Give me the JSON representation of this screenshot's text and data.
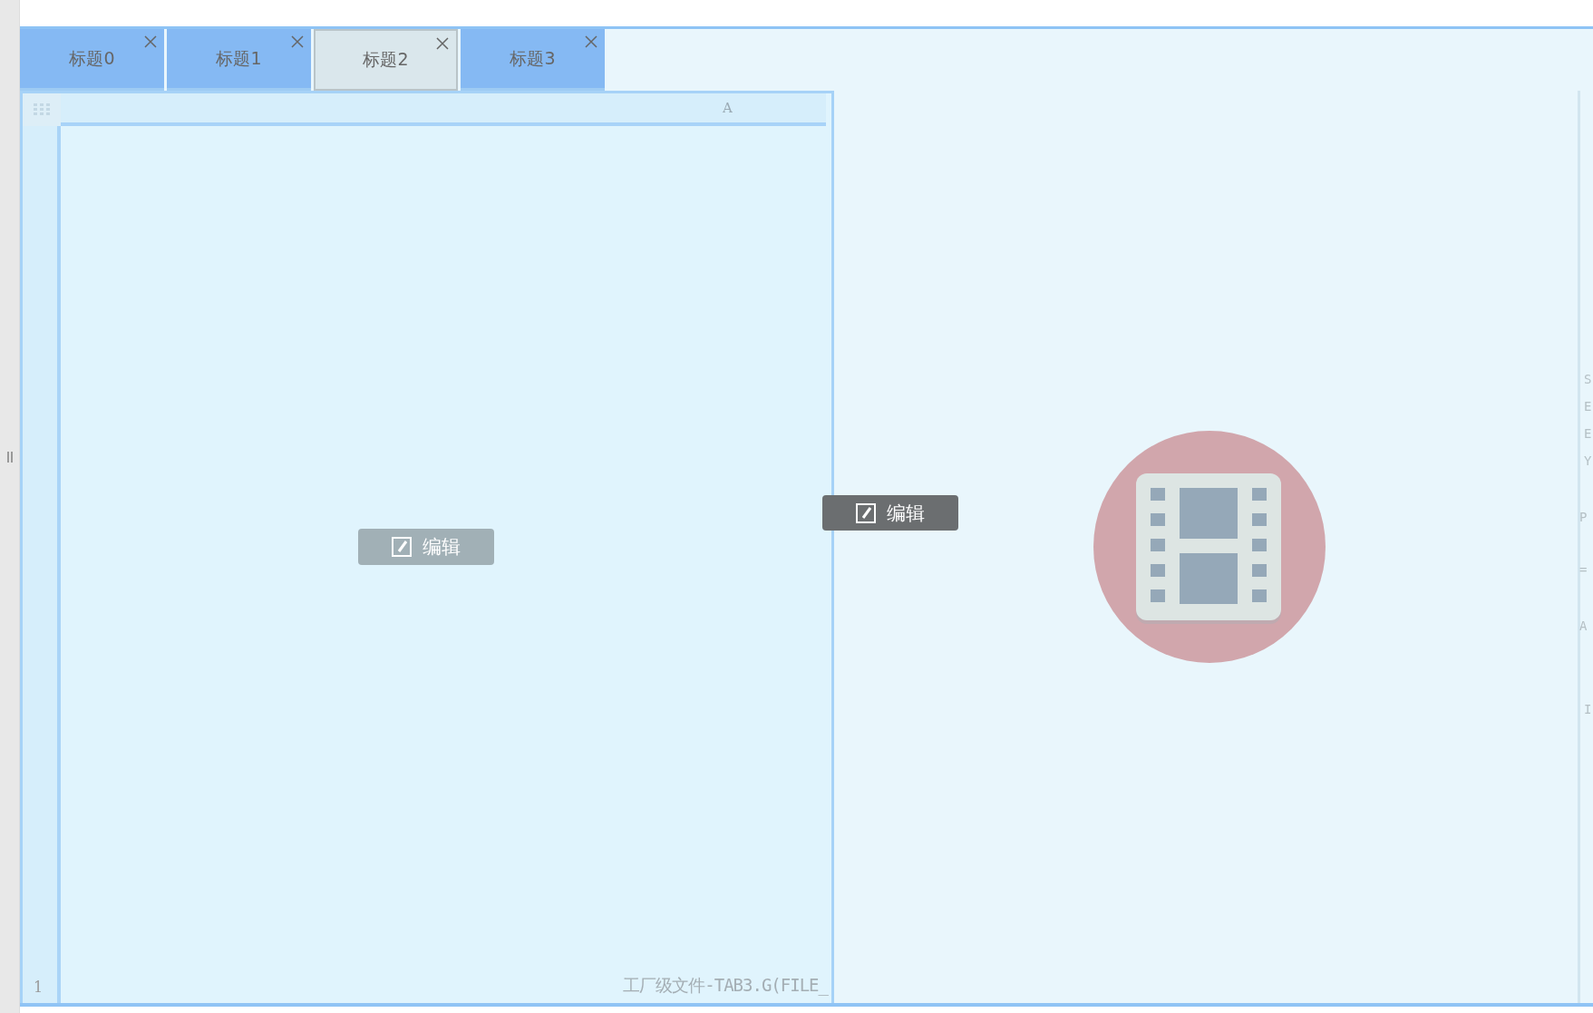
{
  "tabs": [
    {
      "label": "标题0",
      "selected": false
    },
    {
      "label": "标题1",
      "selected": false
    },
    {
      "label": "标题2",
      "selected": true
    },
    {
      "label": "标题3",
      "selected": false
    }
  ],
  "grid": {
    "column_header": "A",
    "row_number": "1",
    "footer_text": "工厂级文件-TAB3.G(FILE_"
  },
  "edit_buttons": [
    {
      "label": "编辑",
      "kind": "faded"
    },
    {
      "label": "编辑",
      "kind": "dark"
    }
  ],
  "right_edge_text": [
    "S",
    "E",
    "E",
    "Y",
    "P",
    "=",
    "A",
    "I"
  ]
}
